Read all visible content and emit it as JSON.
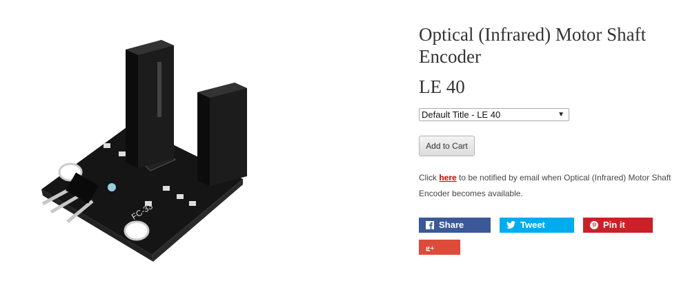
{
  "product": {
    "title": "Optical (Infrared) Motor Shaft Encoder",
    "price": "LE 40",
    "board_marking": "FC-33",
    "image_icon": "ir-encoder-module-image"
  },
  "variant": {
    "selected": "Default Title - LE 40"
  },
  "cart": {
    "add_label": "Add to Cart"
  },
  "notify": {
    "prefix": "Click ",
    "link_text": "here",
    "suffix": " to be notified by email when Optical (Infrared) Motor Shaft Encoder becomes available."
  },
  "share": {
    "facebook": {
      "label": "Share",
      "icon": "facebook-icon",
      "color": "#3b5998"
    },
    "twitter": {
      "label": "Tweet",
      "icon": "twitter-icon",
      "color": "#00aced"
    },
    "pinterest": {
      "label": "Pin it",
      "icon": "pinterest-icon",
      "color": "#cb2027"
    },
    "googleplus": {
      "label": "",
      "icon": "google-plus-icon",
      "color": "#dd4b39"
    }
  },
  "colors": {
    "link": "#cc0000",
    "text": "#333333"
  }
}
